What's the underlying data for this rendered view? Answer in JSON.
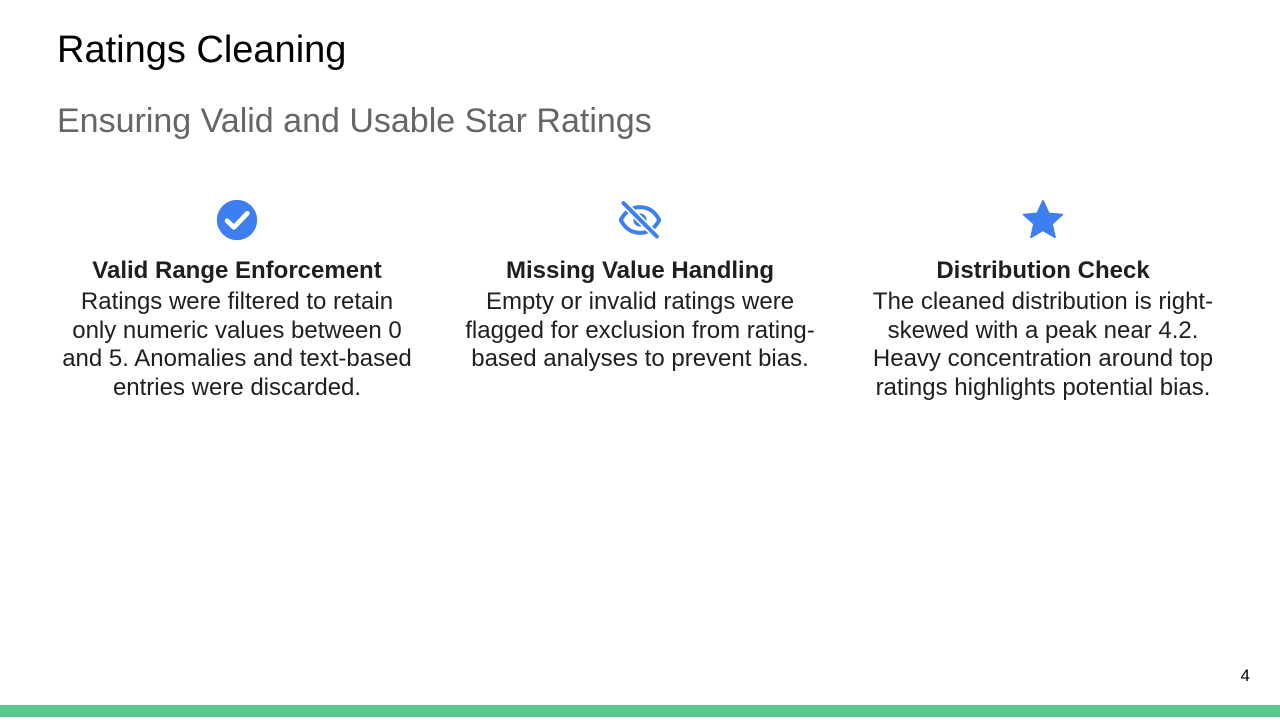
{
  "slide": {
    "title": "Ratings Cleaning",
    "subtitle": "Ensuring Valid and Usable Star Ratings",
    "page_number": "4",
    "accent_color": "#3d7ff0",
    "footer_color": "#5ac990"
  },
  "columns": [
    {
      "icon": "check-circle-icon",
      "heading": "Valid Range Enforcement",
      "body": "Ratings were filtered to retain only numeric values between 0 and 5. Anomalies and text-based entries were discarded."
    },
    {
      "icon": "eye-off-icon",
      "heading": "Missing Value Handling",
      "body": "Empty or invalid ratings were flagged for exclusion from rating-based analyses to prevent bias."
    },
    {
      "icon": "star-icon",
      "heading": "Distribution Check",
      "body": "The cleaned distribution is right-skewed with a peak near 4.2. Heavy concentration around top ratings highlights potential bias."
    }
  ]
}
